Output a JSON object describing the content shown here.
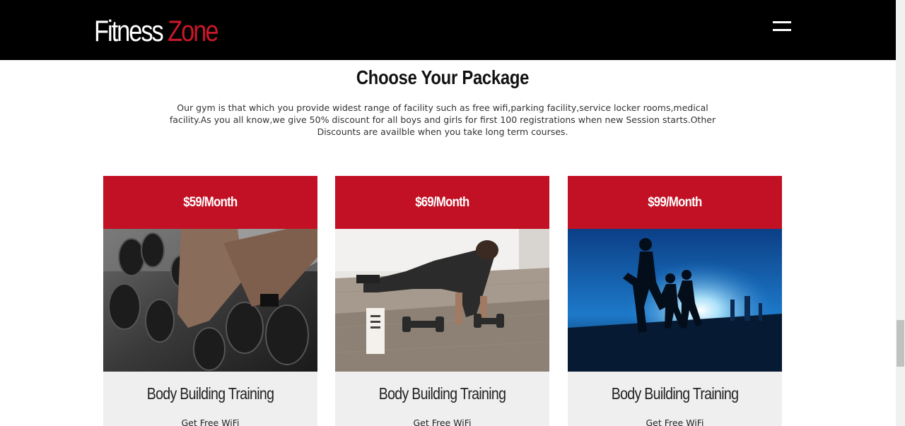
{
  "header": {
    "logo_first": "Fitness",
    "logo_second": "Zone",
    "menu_icon": "hamburger-menu-icon"
  },
  "section": {
    "title": "Choose Your Package",
    "description": "Our gym is that which you provide widest range of facility such as free wifi,parking facility,service locker rooms,medical facility.As you all know,we give 50% discount for all boys and girls for first 100 registrations when new Session starts.Other Discounts are availble when you take long term courses."
  },
  "packages": [
    {
      "price": "$59/Month",
      "image": "dumbbell-rack-photo",
      "title": "Body Building Training",
      "feature": "Get Free WiFi"
    },
    {
      "price": "$69/Month",
      "image": "pushup-with-dumbbells-photo",
      "title": "Body Building Training",
      "feature": "Get Free WiFi"
    },
    {
      "price": "$99/Month",
      "image": "runners-at-sunset-photo",
      "title": "Body Building Training",
      "feature": "Get Free WiFi"
    }
  ],
  "colors": {
    "brand_red": "#c21124",
    "logo_red": "#c8182a",
    "nav_bg": "#000000",
    "card_bg": "#efefef"
  }
}
